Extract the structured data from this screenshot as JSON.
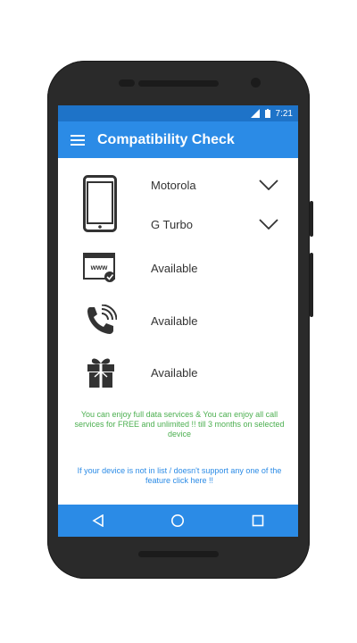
{
  "status_bar": {
    "time": "7:21"
  },
  "app_bar": {
    "title": "Compatibility Check",
    "menu_icon": "hamburger-menu-icon"
  },
  "device": {
    "icon": "smartphone-icon",
    "brand": "Motorola",
    "model": "G Turbo",
    "dropdown_icon": "chevron-down-icon"
  },
  "features": [
    {
      "icon": "web-browser-check-icon",
      "status": "Available"
    },
    {
      "icon": "phone-call-icon",
      "status": "Available"
    },
    {
      "icon": "gift-icon",
      "status": "Available"
    }
  ],
  "offer_message": "You can enjoy full data services & You can enjoy all call services  for FREE and unlimited !! till 3 months on selected device",
  "support_link": "If your device is not in list / doesn't support any one of the feature click here !!",
  "colors": {
    "primary": "#2b8be6",
    "status_bar": "#1e73c8",
    "offer_text": "#4caf50"
  },
  "nav_bar": {
    "back_icon": "back-triangle-icon",
    "home_icon": "home-circle-icon",
    "recents_icon": "recents-square-icon"
  }
}
